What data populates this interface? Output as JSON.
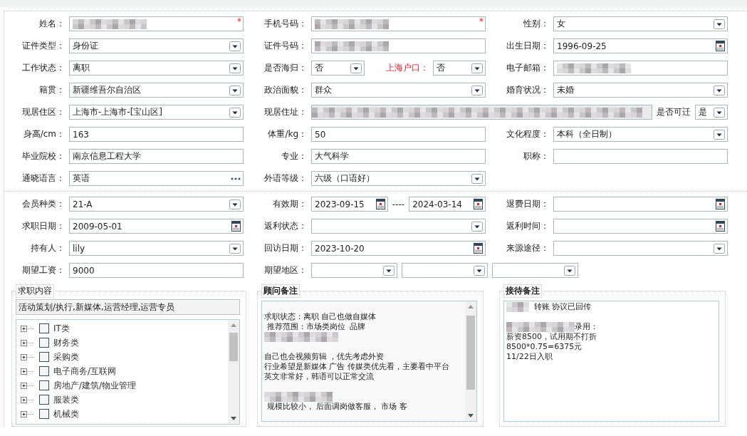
{
  "personal": {
    "rows": [
      {
        "groups": [
          {
            "kind": "normal",
            "label": "姓名：",
            "controls": [
              {
                "kind": "redacted",
                "required_mark": "*"
              }
            ]
          },
          {
            "kind": "normal",
            "label": "手机号码：",
            "controls": [
              {
                "kind": "redacted",
                "required_mark": "*"
              }
            ]
          },
          {
            "kind": "normal",
            "label": "性别：",
            "controls": [
              {
                "kind": "select",
                "value": "女"
              }
            ]
          }
        ]
      },
      {
        "groups": [
          {
            "kind": "normal",
            "label": "证件类型：",
            "controls": [
              {
                "kind": "select",
                "value": "身份证"
              }
            ]
          },
          {
            "kind": "normal",
            "label": "证件号码：",
            "controls": [
              {
                "kind": "redacted"
              }
            ]
          },
          {
            "kind": "normal",
            "label": "出生日期：",
            "controls": [
              {
                "kind": "date",
                "value": "1996-09-25"
              }
            ]
          }
        ]
      },
      {
        "groups": [
          {
            "kind": "normal",
            "label": "工作状态：",
            "controls": [
              {
                "kind": "select",
                "value": "离职"
              }
            ]
          },
          {
            "kind": "normal",
            "label": "是否海归：",
            "controls": [
              {
                "kind": "select",
                "value": "否"
              },
              {
                "kind": "label",
                "text": "上海户口：",
                "highlight": true
              },
              {
                "kind": "select",
                "value": "否"
              }
            ]
          },
          {
            "kind": "normal",
            "label": "电子邮箱：",
            "controls": [
              {
                "kind": "redacted"
              }
            ]
          }
        ]
      },
      {
        "groups": [
          {
            "kind": "normal",
            "label": "籍贯：",
            "controls": [
              {
                "kind": "select",
                "value": "新疆维吾尔自治区"
              }
            ]
          },
          {
            "kind": "normal",
            "label": "政治面貌：",
            "controls": [
              {
                "kind": "select",
                "value": "群众"
              }
            ]
          },
          {
            "kind": "normal",
            "label": "婚育状况：",
            "controls": [
              {
                "kind": "select",
                "value": "未婚"
              }
            ]
          }
        ]
      },
      {
        "groups": [
          {
            "kind": "normal",
            "label": "现居住区：",
            "controls": [
              {
                "kind": "select",
                "value": "上海市-上海市-[宝山区]"
              }
            ]
          },
          {
            "kind": "address",
            "label": "现居住址：",
            "controls": [
              {
                "kind": "redacted"
              },
              {
                "kind": "label",
                "text": "是否可迁",
                "highlight": false
              },
              {
                "kind": "select",
                "value": "是"
              }
            ]
          }
        ]
      },
      {
        "groups": [
          {
            "kind": "normal",
            "label": "身高/cm：",
            "controls": [
              {
                "kind": "text",
                "value": "163"
              }
            ]
          },
          {
            "kind": "normal",
            "label": "体重/kg：",
            "controls": [
              {
                "kind": "text",
                "value": "50"
              }
            ]
          },
          {
            "kind": "normal",
            "label": "文化程度：",
            "controls": [
              {
                "kind": "select",
                "value": "本科（全日制）"
              }
            ]
          }
        ]
      },
      {
        "groups": [
          {
            "kind": "normal",
            "label": "毕业院校：",
            "controls": [
              {
                "kind": "text",
                "value": "南京信息工程大学"
              }
            ]
          },
          {
            "kind": "normal",
            "label": "专业：",
            "controls": [
              {
                "kind": "text",
                "value": "大气科学"
              }
            ]
          },
          {
            "kind": "normal",
            "label": "职称：",
            "controls": [
              {
                "kind": "text"
              }
            ]
          }
        ]
      },
      {
        "groups": [
          {
            "kind": "normal",
            "label": "通晓语言：",
            "controls": [
              {
                "kind": "lookup",
                "value": "英语"
              }
            ]
          },
          {
            "kind": "normal",
            "label": "外语等级：",
            "controls": [
              {
                "kind": "select",
                "value": "六级（口语好）"
              }
            ]
          }
        ]
      }
    ]
  },
  "membership": {
    "rows": [
      {
        "groups": [
          {
            "kind": "normal",
            "label": "会员种类：",
            "controls": [
              {
                "kind": "select",
                "value": "21-A"
              }
            ]
          },
          {
            "kind": "normal",
            "label": "有效期：",
            "controls": [
              {
                "kind": "date",
                "value": "2023-09-15"
              },
              {
                "kind": "separator",
                "text": "----"
              },
              {
                "kind": "date",
                "value": "2024-03-14"
              }
            ]
          },
          {
            "kind": "normal",
            "label": "退费日期：",
            "controls": [
              {
                "kind": "date"
              }
            ]
          }
        ]
      },
      {
        "groups": [
          {
            "kind": "normal",
            "label": "求职日期：",
            "controls": [
              {
                "kind": "date",
                "value": "2009-05-01"
              }
            ]
          },
          {
            "kind": "normal",
            "label": "返利状态：",
            "controls": [
              {
                "kind": "select"
              }
            ]
          },
          {
            "kind": "normal",
            "label": "返利时间：",
            "controls": [
              {
                "kind": "date"
              }
            ]
          }
        ]
      },
      {
        "groups": [
          {
            "kind": "normal",
            "label": "持有人：",
            "controls": [
              {
                "kind": "select",
                "value": "lily"
              }
            ]
          },
          {
            "kind": "normal",
            "label": "回访日期：",
            "controls": [
              {
                "kind": "date",
                "value": "2023-10-20"
              }
            ]
          },
          {
            "kind": "normal",
            "label": "来源途径：",
            "controls": [
              {
                "kind": "select"
              }
            ]
          }
        ]
      },
      {
        "groups": [
          {
            "kind": "normal",
            "label": "期望工资：",
            "controls": [
              {
                "kind": "text",
                "value": "9000"
              }
            ]
          },
          {
            "kind": "region",
            "label": "期望地区：",
            "controls": [
              {
                "kind": "select"
              },
              {
                "kind": "select"
              },
              {
                "kind": "select"
              }
            ]
          }
        ]
      }
    ]
  },
  "job_intent": {
    "title": "求职内容",
    "summary": "活动策划/执行,新媒体,运营经理,运营专员",
    "tree": [
      {
        "label": "IT类",
        "checked": false,
        "expanded": false
      },
      {
        "label": "财务类",
        "checked": false,
        "expanded": false
      },
      {
        "label": "采购类",
        "checked": false,
        "expanded": false
      },
      {
        "label": "电子商务/互联网",
        "checked": false,
        "expanded": false
      },
      {
        "label": "房地产/建筑/物业管理",
        "checked": false,
        "expanded": false
      },
      {
        "label": "服装类",
        "checked": false,
        "expanded": false
      },
      {
        "label": "机械类",
        "checked": false,
        "expanded": false
      }
    ]
  },
  "advisor_notes": {
    "title": "顾问备注",
    "lines": [
      {
        "kind": "blank"
      },
      {
        "kind": "text",
        "text": "求职状态：离职 自己也做自媒体"
      },
      {
        "kind": "text",
        "text": " 推荐范围：市场类岗位  品牌"
      },
      {
        "kind": "redacted"
      },
      {
        "kind": "blank"
      },
      {
        "kind": "text",
        "text": "自己也会视频剪辑 ，优先考虑外资"
      },
      {
        "kind": "text",
        "text": "行业希望是新媒体 广告 传媒类优先看，主要看中平台"
      },
      {
        "kind": "text",
        "text": "英文非常好，韩语可以正常交流"
      },
      {
        "kind": "blank"
      },
      {
        "kind": "redacted-prefix",
        "text": " 规模比较小， 后面调岗做客服， 市场 客"
      }
    ]
  },
  "reception_notes": {
    "title": "接待备注",
    "lines": [
      {
        "kind": "redacted-prefix",
        "text": "  转账 协议已回传"
      },
      {
        "kind": "blank"
      },
      {
        "kind": "redacted-prefix",
        "text": "录用："
      },
      {
        "kind": "text",
        "text": "薪资8500，试用期不打折"
      },
      {
        "kind": "text",
        "text": "8500*0.75=6375元"
      },
      {
        "kind": "text",
        "text": "11/22日入职"
      }
    ]
  }
}
